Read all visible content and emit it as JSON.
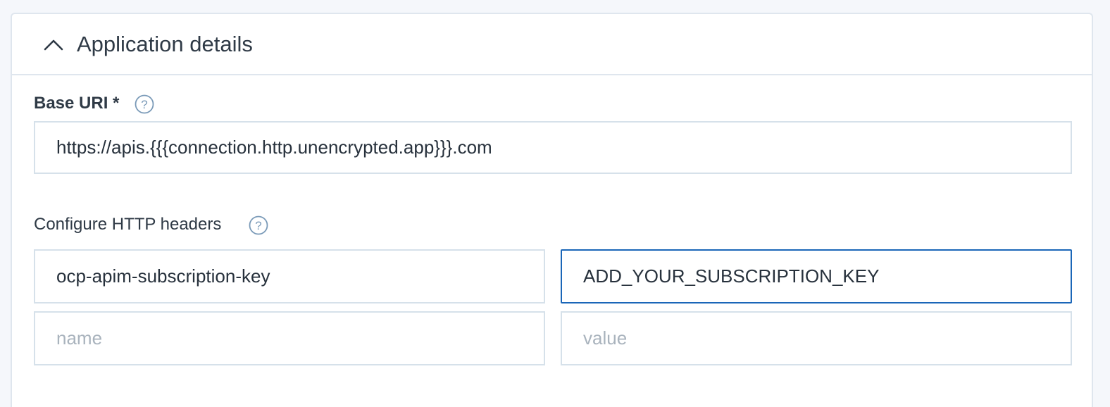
{
  "section": {
    "title": "Application details",
    "chevron_icon": "chevron-up-icon"
  },
  "base_uri": {
    "label": "Base URI *",
    "help_icon": "help-icon",
    "value": "https://apis.{{{connection.http.unencrypted.app}}}.com"
  },
  "http_headers": {
    "label": "Configure HTTP headers",
    "help_icon": "help-icon",
    "rows": [
      {
        "name": "ocp-apim-subscription-key",
        "value": "ADD_YOUR_SUBSCRIPTION_KEY"
      },
      {
        "name": "",
        "value": ""
      }
    ],
    "name_placeholder": "name",
    "value_placeholder": "value"
  },
  "colors": {
    "focus_border": "#1a66b8",
    "input_border": "#d6e1ea",
    "help_icon": "#7a9ab8",
    "background": "#f5f7fb"
  }
}
